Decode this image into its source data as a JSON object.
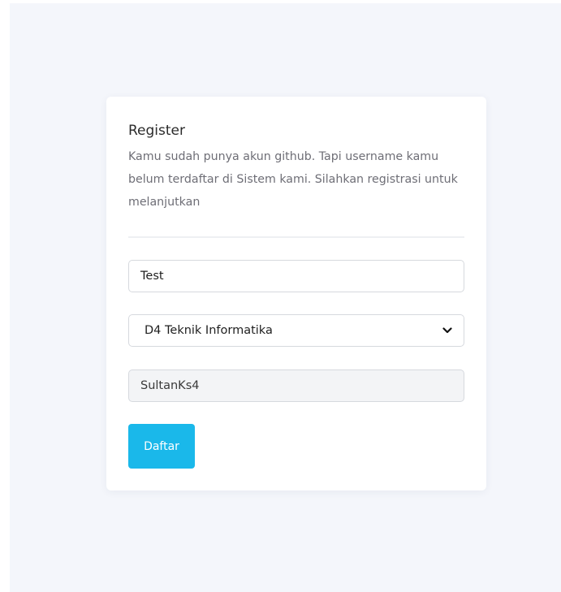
{
  "register": {
    "title": "Register",
    "description": "Kamu sudah punya akun github. Tapi username kamu belum terdaftar di Sistem kami. Silahkan registrasi untuk melanjutkan",
    "name_value": "Test",
    "program_value": "D4 Teknik Informatika",
    "username_value": "SultanKs4",
    "submit_label": "Daftar"
  },
  "colors": {
    "accent": "#1ab8ea",
    "background": "#f4f6fb"
  },
  "icons": {
    "select_arrow": "chevron-down-icon"
  }
}
